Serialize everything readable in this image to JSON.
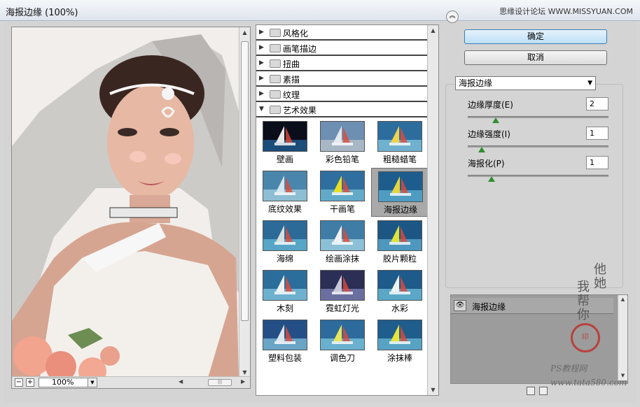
{
  "window": {
    "title": "海报边缘 (100%)",
    "brand": "思缘设计论坛 WWW.MISSYUAN.COM"
  },
  "preview": {
    "zoom": "100%",
    "zoom_out": "−",
    "zoom_in": "+"
  },
  "categories": [
    {
      "label": "风格化",
      "expanded": false
    },
    {
      "label": "画笔描边",
      "expanded": false
    },
    {
      "label": "扭曲",
      "expanded": false
    },
    {
      "label": "素描",
      "expanded": false
    },
    {
      "label": "纹理",
      "expanded": false
    },
    {
      "label": "艺术效果",
      "expanded": true
    }
  ],
  "filters": [
    {
      "label": "壁画",
      "colors": [
        "#0a0d1a",
        "#1c4d7a",
        "#e8e8e8"
      ]
    },
    {
      "label": "彩色铅笔",
      "colors": [
        "#6d8fb1",
        "#a7b7c6",
        "#e4e9ef"
      ]
    },
    {
      "label": "粗糙蜡笔",
      "colors": [
        "#2d6d9e",
        "#6fb1cf",
        "#f0d24a"
      ]
    },
    {
      "label": "底纹效果",
      "colors": [
        "#4a86ac",
        "#8dbed4",
        "#d5e7ef"
      ]
    },
    {
      "label": "干画笔",
      "colors": [
        "#2f6f9f",
        "#63aac9",
        "#e8e020"
      ]
    },
    {
      "label": "海报边缘",
      "colors": [
        "#1d5d8e",
        "#4e9cc2",
        "#e2d53f"
      ],
      "selected": true
    },
    {
      "label": "海绵",
      "colors": [
        "#2c6a98",
        "#57a6c7",
        "#d6e0df"
      ]
    },
    {
      "label": "绘画涂抹",
      "colors": [
        "#3f7ca6",
        "#8cc0d6",
        "#f2f2f2"
      ]
    },
    {
      "label": "胶片颗粒",
      "colors": [
        "#1b5684",
        "#4e97bd",
        "#e0e23a"
      ]
    },
    {
      "label": "木刻",
      "colors": [
        "#2b6e9c",
        "#6db1cf",
        "#eef2f3"
      ]
    },
    {
      "label": "霓虹灯光",
      "colors": [
        "#2b2f55",
        "#6a6fa0",
        "#c8c8d8"
      ]
    },
    {
      "label": "水彩",
      "colors": [
        "#1e5a8a",
        "#5aa7c7",
        "#f0f2ef"
      ]
    },
    {
      "label": "塑料包装",
      "colors": [
        "#244f86",
        "#6aa4c6",
        "#d9e6ec"
      ]
    },
    {
      "label": "调色刀",
      "colors": [
        "#2c6b9c",
        "#6ab0cf",
        "#e6e65a"
      ]
    },
    {
      "label": "涂抹棒",
      "colors": [
        "#1e5d8c",
        "#58a3c4",
        "#eae436"
      ]
    }
  ],
  "buttons": {
    "ok": "确定",
    "cancel": "取消"
  },
  "filter_select": "海报边缘",
  "params": [
    {
      "label": "边缘厚度(E)",
      "value": "2",
      "level": 0.2
    },
    {
      "label": "边缘强度(I)",
      "value": "1",
      "level": 0.1
    },
    {
      "label": "海报化(P)",
      "value": "1",
      "level": 0.17
    }
  ],
  "effect_layer": {
    "name": "海报边缘"
  },
  "watermark": {
    "line1": "他她",
    "line2": "我帮你",
    "seal": "印",
    "site1": "PS教程网",
    "site2": "www.tata580.com"
  }
}
